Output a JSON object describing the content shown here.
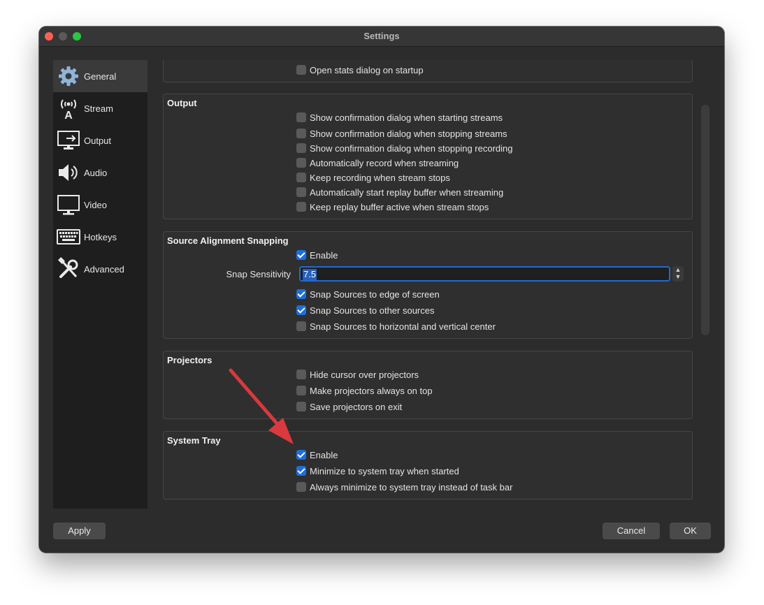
{
  "window": {
    "title": "Settings"
  },
  "sidebar": {
    "items": [
      {
        "label": "General",
        "icon": "gear-icon"
      },
      {
        "label": "Stream",
        "icon": "broadcast-antenna-icon"
      },
      {
        "label": "Output",
        "icon": "output-monitor-icon"
      },
      {
        "label": "Audio",
        "icon": "speaker-icon"
      },
      {
        "label": "Video",
        "icon": "monitor-icon"
      },
      {
        "label": "Hotkeys",
        "icon": "keyboard-icon"
      },
      {
        "label": "Advanced",
        "icon": "tools-icon"
      }
    ]
  },
  "general": {
    "top_option": {
      "label": "Open stats dialog on startup",
      "checked": false
    }
  },
  "output": {
    "title": "Output",
    "options": [
      {
        "label": "Show confirmation dialog when starting streams",
        "checked": false
      },
      {
        "label": "Show confirmation dialog when stopping streams",
        "checked": false
      },
      {
        "label": "Show confirmation dialog when stopping recording",
        "checked": false
      },
      {
        "label": "Automatically record when streaming",
        "checked": false
      },
      {
        "label": "Keep recording when stream stops",
        "checked": false
      },
      {
        "label": "Automatically start replay buffer when streaming",
        "checked": false
      },
      {
        "label": "Keep replay buffer active when stream stops",
        "checked": false
      }
    ]
  },
  "snapping": {
    "title": "Source Alignment Snapping",
    "enable": {
      "label": "Enable",
      "checked": true
    },
    "sensitivity_label": "Snap Sensitivity",
    "sensitivity_value": "7.5",
    "options": [
      {
        "label": "Snap Sources to edge of screen",
        "checked": true
      },
      {
        "label": "Snap Sources to other sources",
        "checked": true
      },
      {
        "label": "Snap Sources to horizontal and vertical center",
        "checked": false
      }
    ]
  },
  "projectors": {
    "title": "Projectors",
    "options": [
      {
        "label": "Hide cursor over projectors",
        "checked": false
      },
      {
        "label": "Make projectors always on top",
        "checked": false
      },
      {
        "label": "Save projectors on exit",
        "checked": false
      }
    ]
  },
  "system_tray": {
    "title": "System Tray",
    "options": [
      {
        "label": "Enable",
        "checked": true
      },
      {
        "label": "Minimize to system tray when started",
        "checked": true
      },
      {
        "label": "Always minimize to system tray instead of task bar",
        "checked": false
      }
    ]
  },
  "buttons": {
    "apply": "Apply",
    "cancel": "Cancel",
    "ok": "OK"
  },
  "colors": {
    "accent": "#1a6fe0",
    "annotation_arrow": "#d9393f"
  }
}
